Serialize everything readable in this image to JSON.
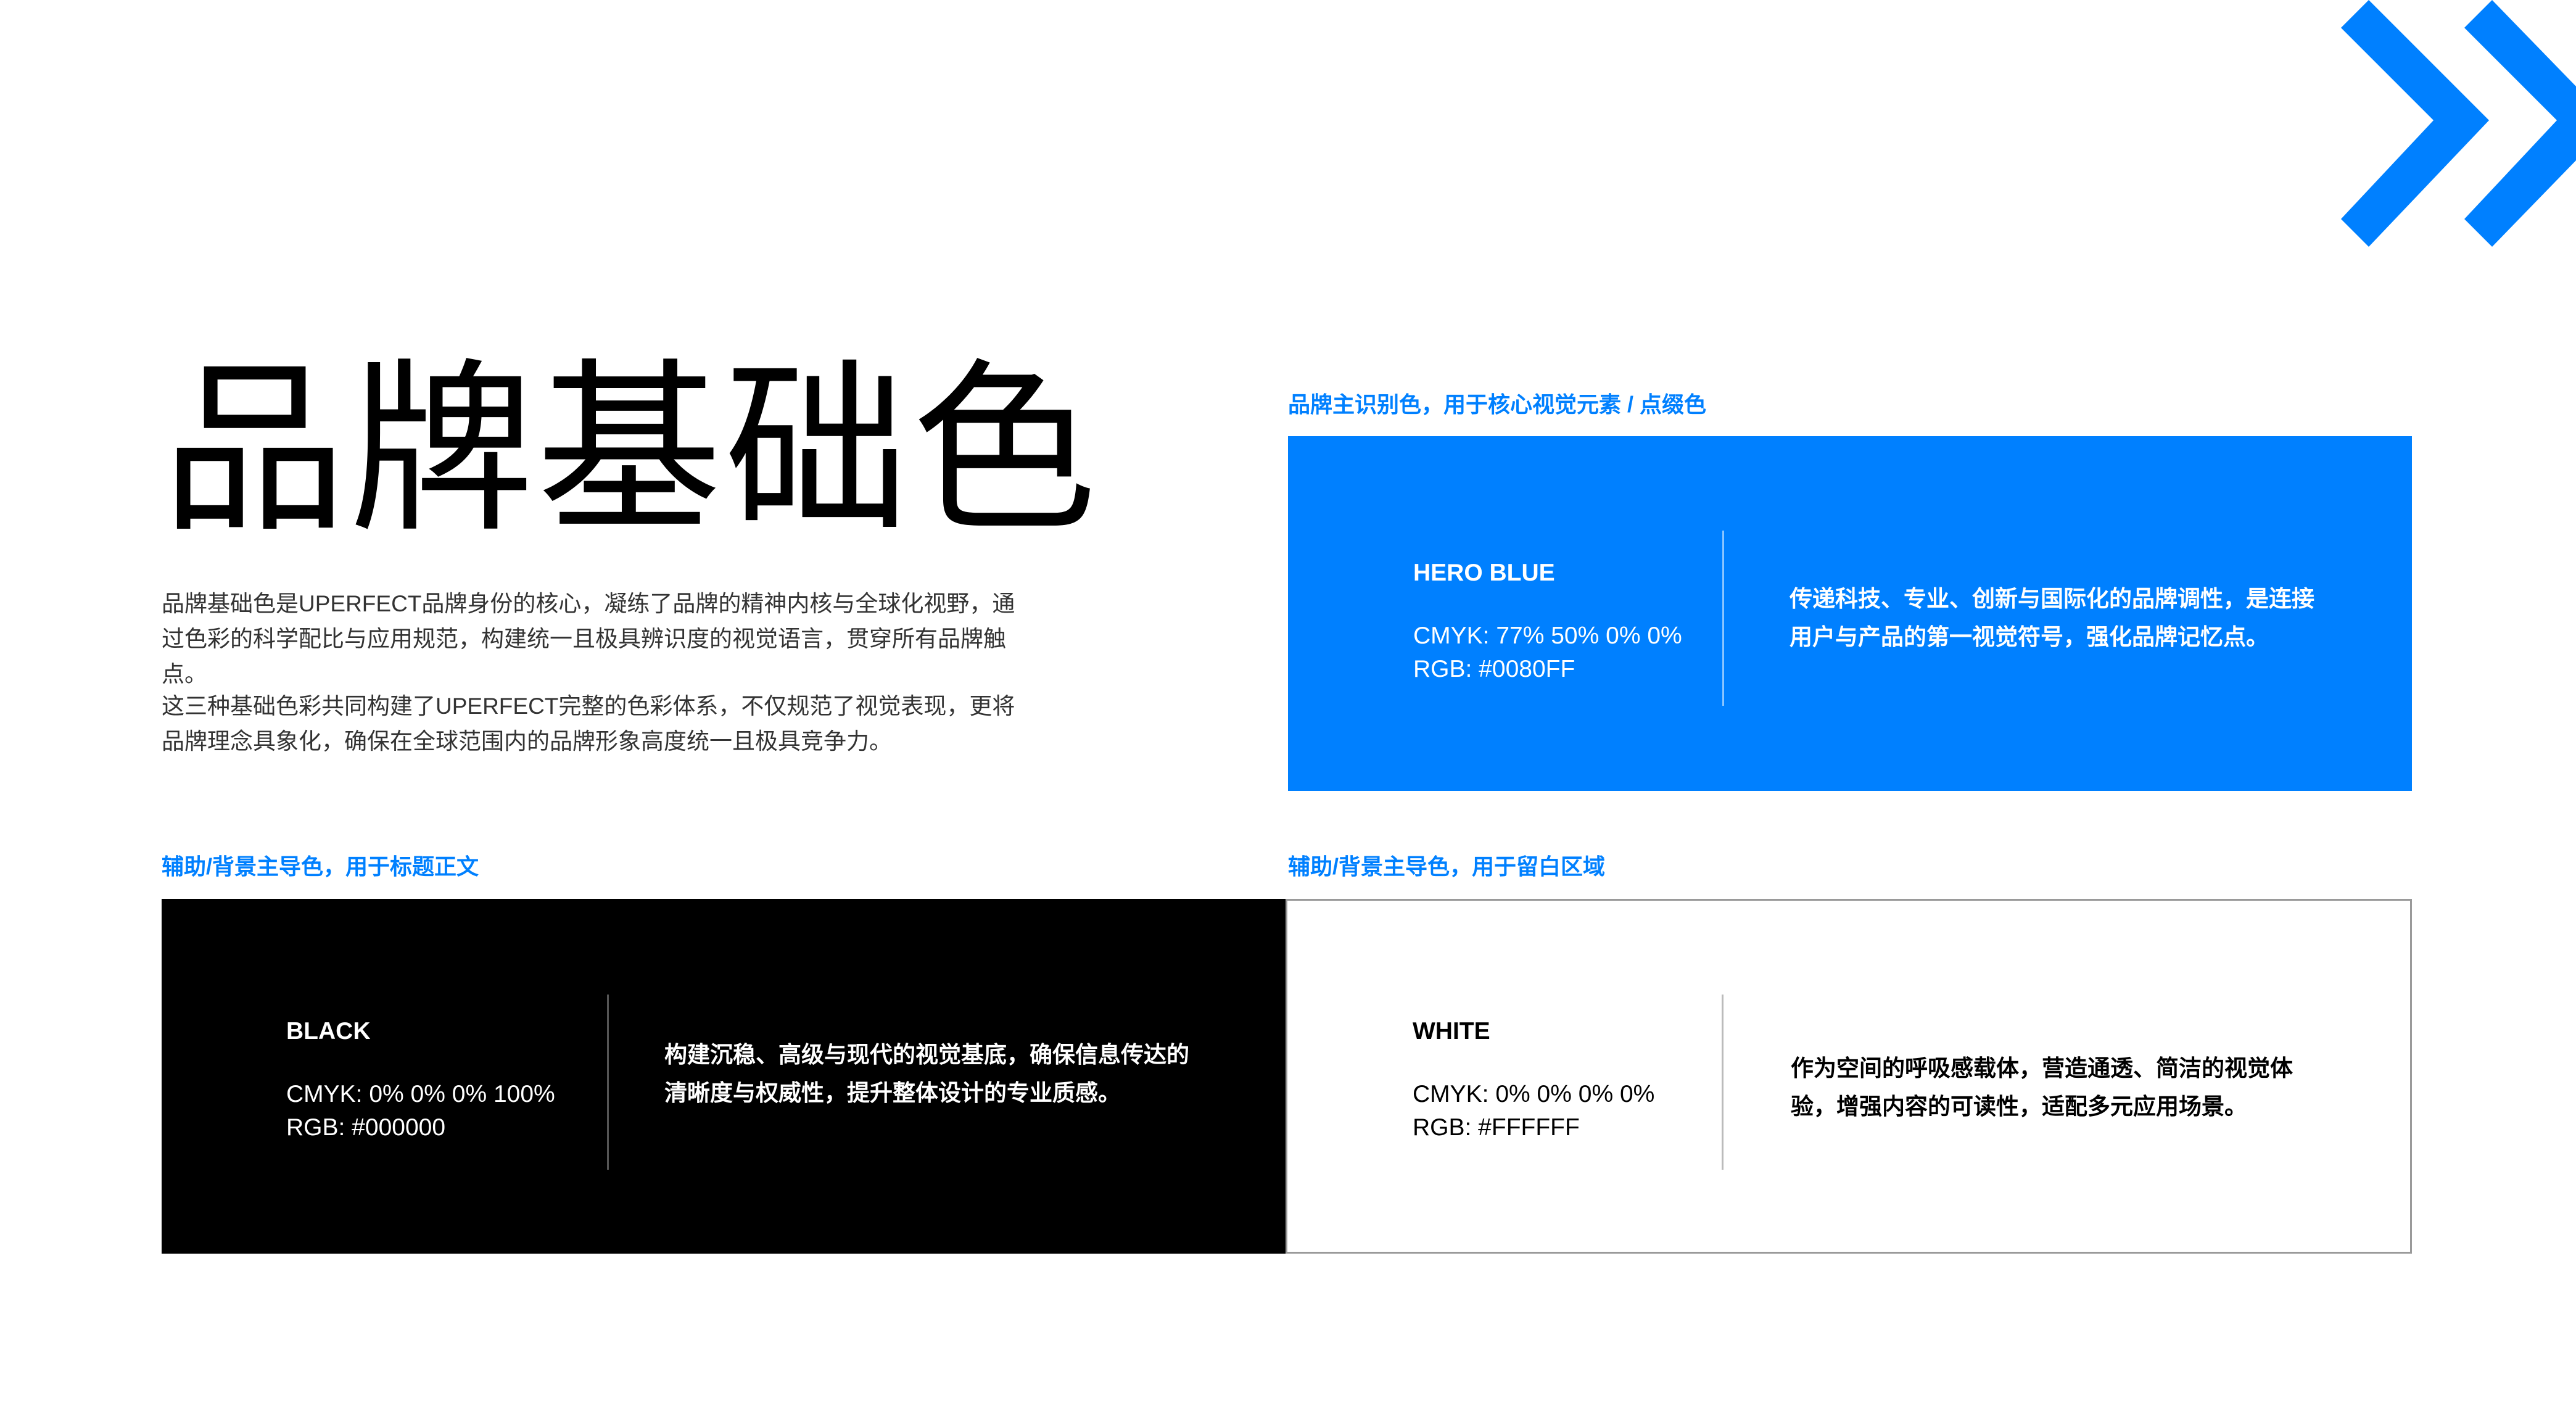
{
  "page": {
    "title": "品牌基础色",
    "intro_paragraphs": [
      "品牌基础色是UPERFECT品牌身份的核心，凝练了品牌的精神内核与全球化视野，通过色彩的科学配比与应用规范，构建统一且极具辨识度的视觉语言，贯穿所有品牌触点。",
      "这三种基础色彩共同构建了UPERFECT完整的色彩体系，不仅规范了视觉表现，更将品牌理念具象化，确保在全球范围内的品牌形象高度统一且极具竞争力。"
    ]
  },
  "logo": {
    "icon": "double-chevron-right-icon",
    "color": "#0080FF"
  },
  "colors": {
    "hero": {
      "caption": "品牌主识别色，用于核心视觉元素 / 点缀色",
      "name": "HERO BLUE",
      "cmyk": "CMYK: 77% 50% 0% 0%",
      "rgb": "RGB: #0080FF",
      "description": "传递科技、专业、创新与国际化的品牌调性，是连接用户与产品的第一视觉符号，强化品牌记忆点。",
      "swatch_hex": "#0080FF"
    },
    "black": {
      "caption": "辅助/背景主导色，用于标题正文",
      "name": "BLACK",
      "cmyk": "CMYK: 0% 0% 0% 100%",
      "rgb": "RGB: #000000",
      "description": "构建沉稳、高级与现代的视觉基底，确保信息传达的清晰度与权威性，提升整体设计的专业质感。",
      "swatch_hex": "#000000"
    },
    "white": {
      "caption": "辅助/背景主导色，用于留白区域",
      "name": "WHITE",
      "cmyk": "CMYK: 0% 0% 0% 0%",
      "rgb": "RGB: #FFFFFF",
      "description": "作为空间的呼吸感载体，营造通透、简洁的视觉体验，增强内容的可读性，适配多元应用场景。",
      "swatch_hex": "#FFFFFF"
    }
  }
}
